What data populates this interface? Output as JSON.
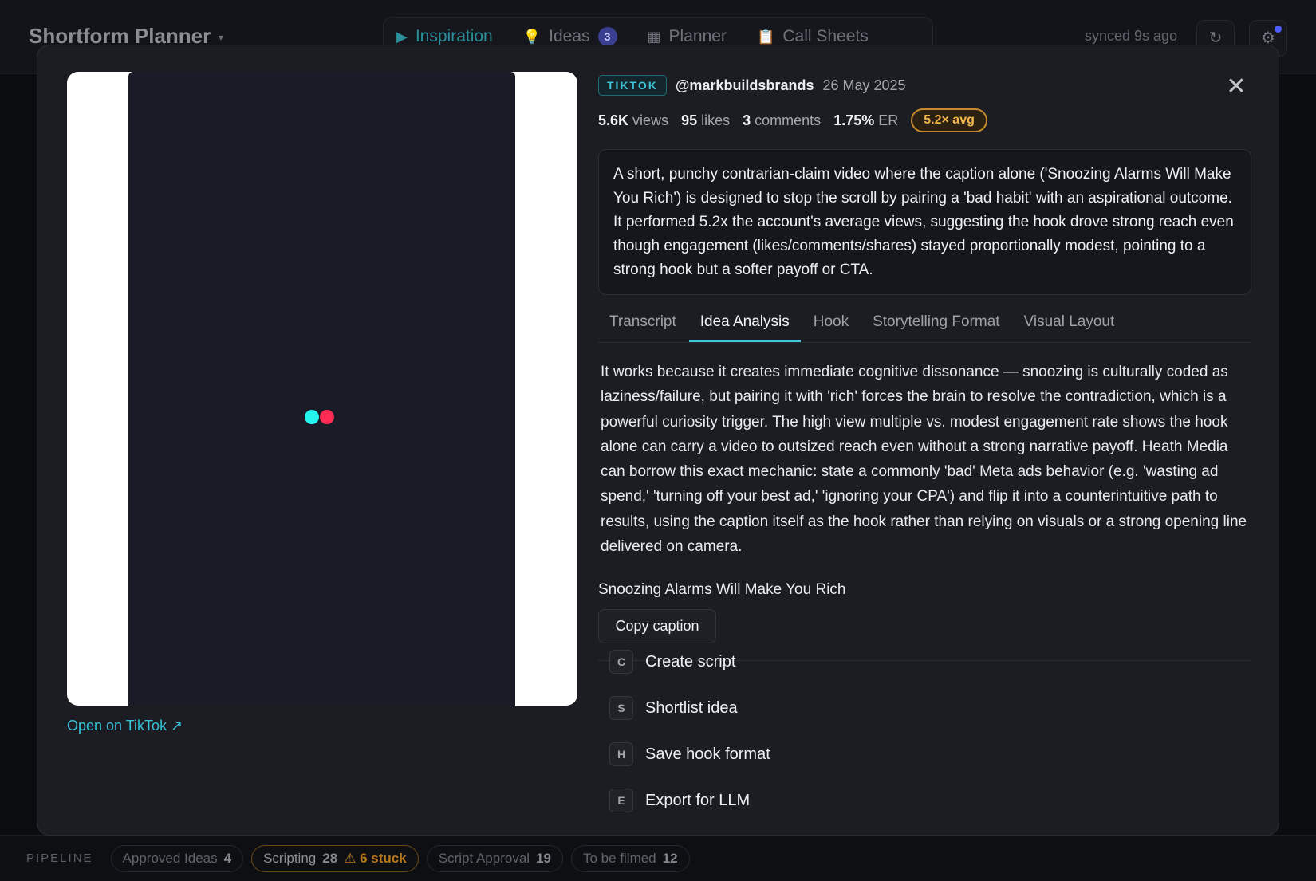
{
  "app": {
    "title": "Shortform Planner",
    "caret": "▾",
    "nav": [
      {
        "label": "Inspiration",
        "icon": "▶",
        "active": true
      },
      {
        "label": "Ideas",
        "icon": "💡",
        "badge": "3"
      },
      {
        "label": "Planner",
        "icon": "▦"
      },
      {
        "label": "Call Sheets",
        "icon": "📋"
      }
    ],
    "synced": "synced 9s ago",
    "refresh_icon": "↻",
    "settings_icon": "⚙"
  },
  "pipeline": {
    "label": "PIPELINE",
    "stages": [
      {
        "label": "Approved Ideas",
        "count": "4"
      },
      {
        "label": "Scripting",
        "count": "28",
        "warning": "⚠ 6 stuck"
      },
      {
        "label": "Script Approval",
        "count": "19"
      },
      {
        "label": "To be filmed",
        "count": "12"
      }
    ]
  },
  "modal": {
    "platform": "TIKTOK",
    "handle": "@markbuildsbrands",
    "date": "26 May 2025",
    "close_icon": "✕",
    "stats": {
      "views": "5.6K",
      "views_label": "views",
      "likes": "95",
      "likes_label": "likes",
      "comments": "3",
      "comments_label": "comments",
      "er": "1.75%",
      "er_label": "ER",
      "avg": "5.2× avg"
    },
    "summary": "A short, punchy contrarian-claim video where the caption alone ('Snoozing Alarms Will Make You Rich') is designed to stop the scroll by pairing a 'bad habit' with an aspirational outcome. It performed 5.2x the account's average views, suggesting the hook drove strong reach even though engagement (likes/comments/shares) stayed proportionally modest, pointing to a strong hook but a softer payoff or CTA.",
    "tabs": [
      "Transcript",
      "Idea Analysis",
      "Hook",
      "Storytelling Format",
      "Visual Layout"
    ],
    "analysis": "It works because it creates immediate cognitive dissonance — snoozing is culturally coded as laziness/failure, but pairing it with 'rich' forces the brain to resolve the contradiction, which is a powerful curiosity trigger. The high view multiple vs. modest engagement rate shows the hook alone can carry a video to outsized reach even without a strong narrative payoff. Heath Media can borrow this exact mechanic: state a commonly 'bad' Meta ads behavior (e.g. 'wasting ad spend,' 'turning off your best ad,' 'ignoring your CPA') and flip it into a counterintuitive path to results, using the caption itself as the hook rather than relying on visuals or a strong opening line delivered on camera.",
    "caption": "Snoozing Alarms Will Make You Rich",
    "copy_caption": "Copy caption",
    "open_link": "Open on TikTok ↗",
    "actions": [
      {
        "key": "C",
        "label": "Create script"
      },
      {
        "key": "S",
        "label": "Shortlist idea"
      },
      {
        "key": "H",
        "label": "Save hook format"
      },
      {
        "key": "E",
        "label": "Export for LLM"
      }
    ],
    "colors": {
      "accent": "#3ec6d8",
      "avg_badge": "#f2b54a",
      "tiktok_cyan": "#25f4ee",
      "tiktok_red": "#fe2c55"
    }
  }
}
